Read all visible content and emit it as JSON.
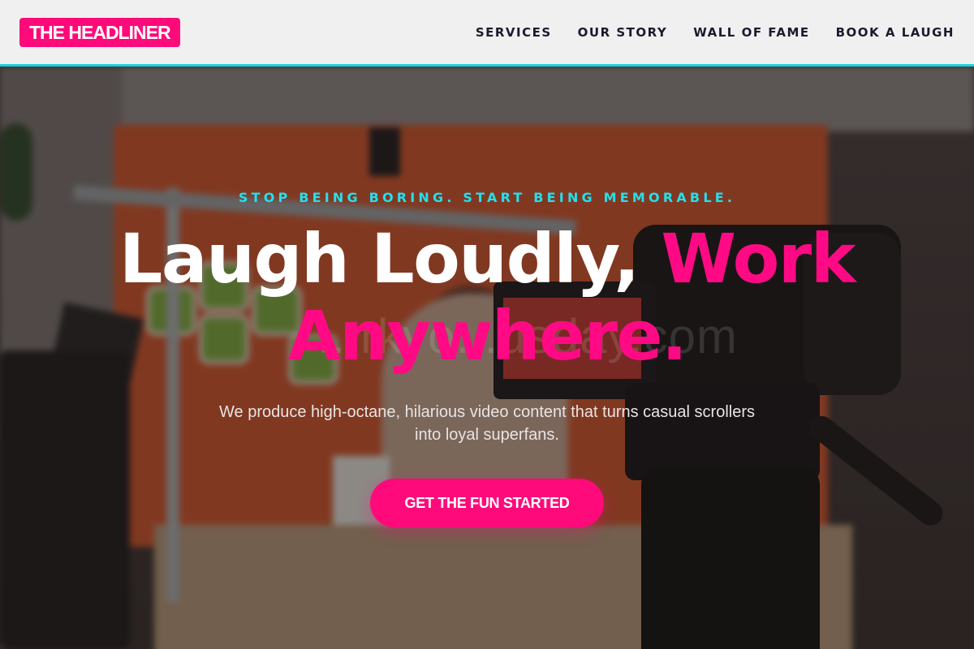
{
  "header": {
    "logo": "THE HEADLINER",
    "nav": [
      {
        "label": "SERVICES"
      },
      {
        "label": "OUR STORY"
      },
      {
        "label": "WALL OF FAME"
      },
      {
        "label": "BOOK A LAUGH"
      }
    ]
  },
  "hero": {
    "tagline": "STOP BEING BORING. START BEING MEMORABLE.",
    "headline_white": "Laugh Loudly, ",
    "headline_accent": "Work Anywhere.",
    "subtext": "We produce high-octane, hilarious video content that turns casual scrollers into loyal superfans.",
    "cta": "GET THE FUN STARTED",
    "watermark": "...rkyo...usday.com"
  },
  "colors": {
    "brand_pink": "#ff0a7a",
    "accent_cyan": "#22e0ee",
    "header_bg": "#f0f0f0",
    "nav_text": "#1b1b2e"
  }
}
